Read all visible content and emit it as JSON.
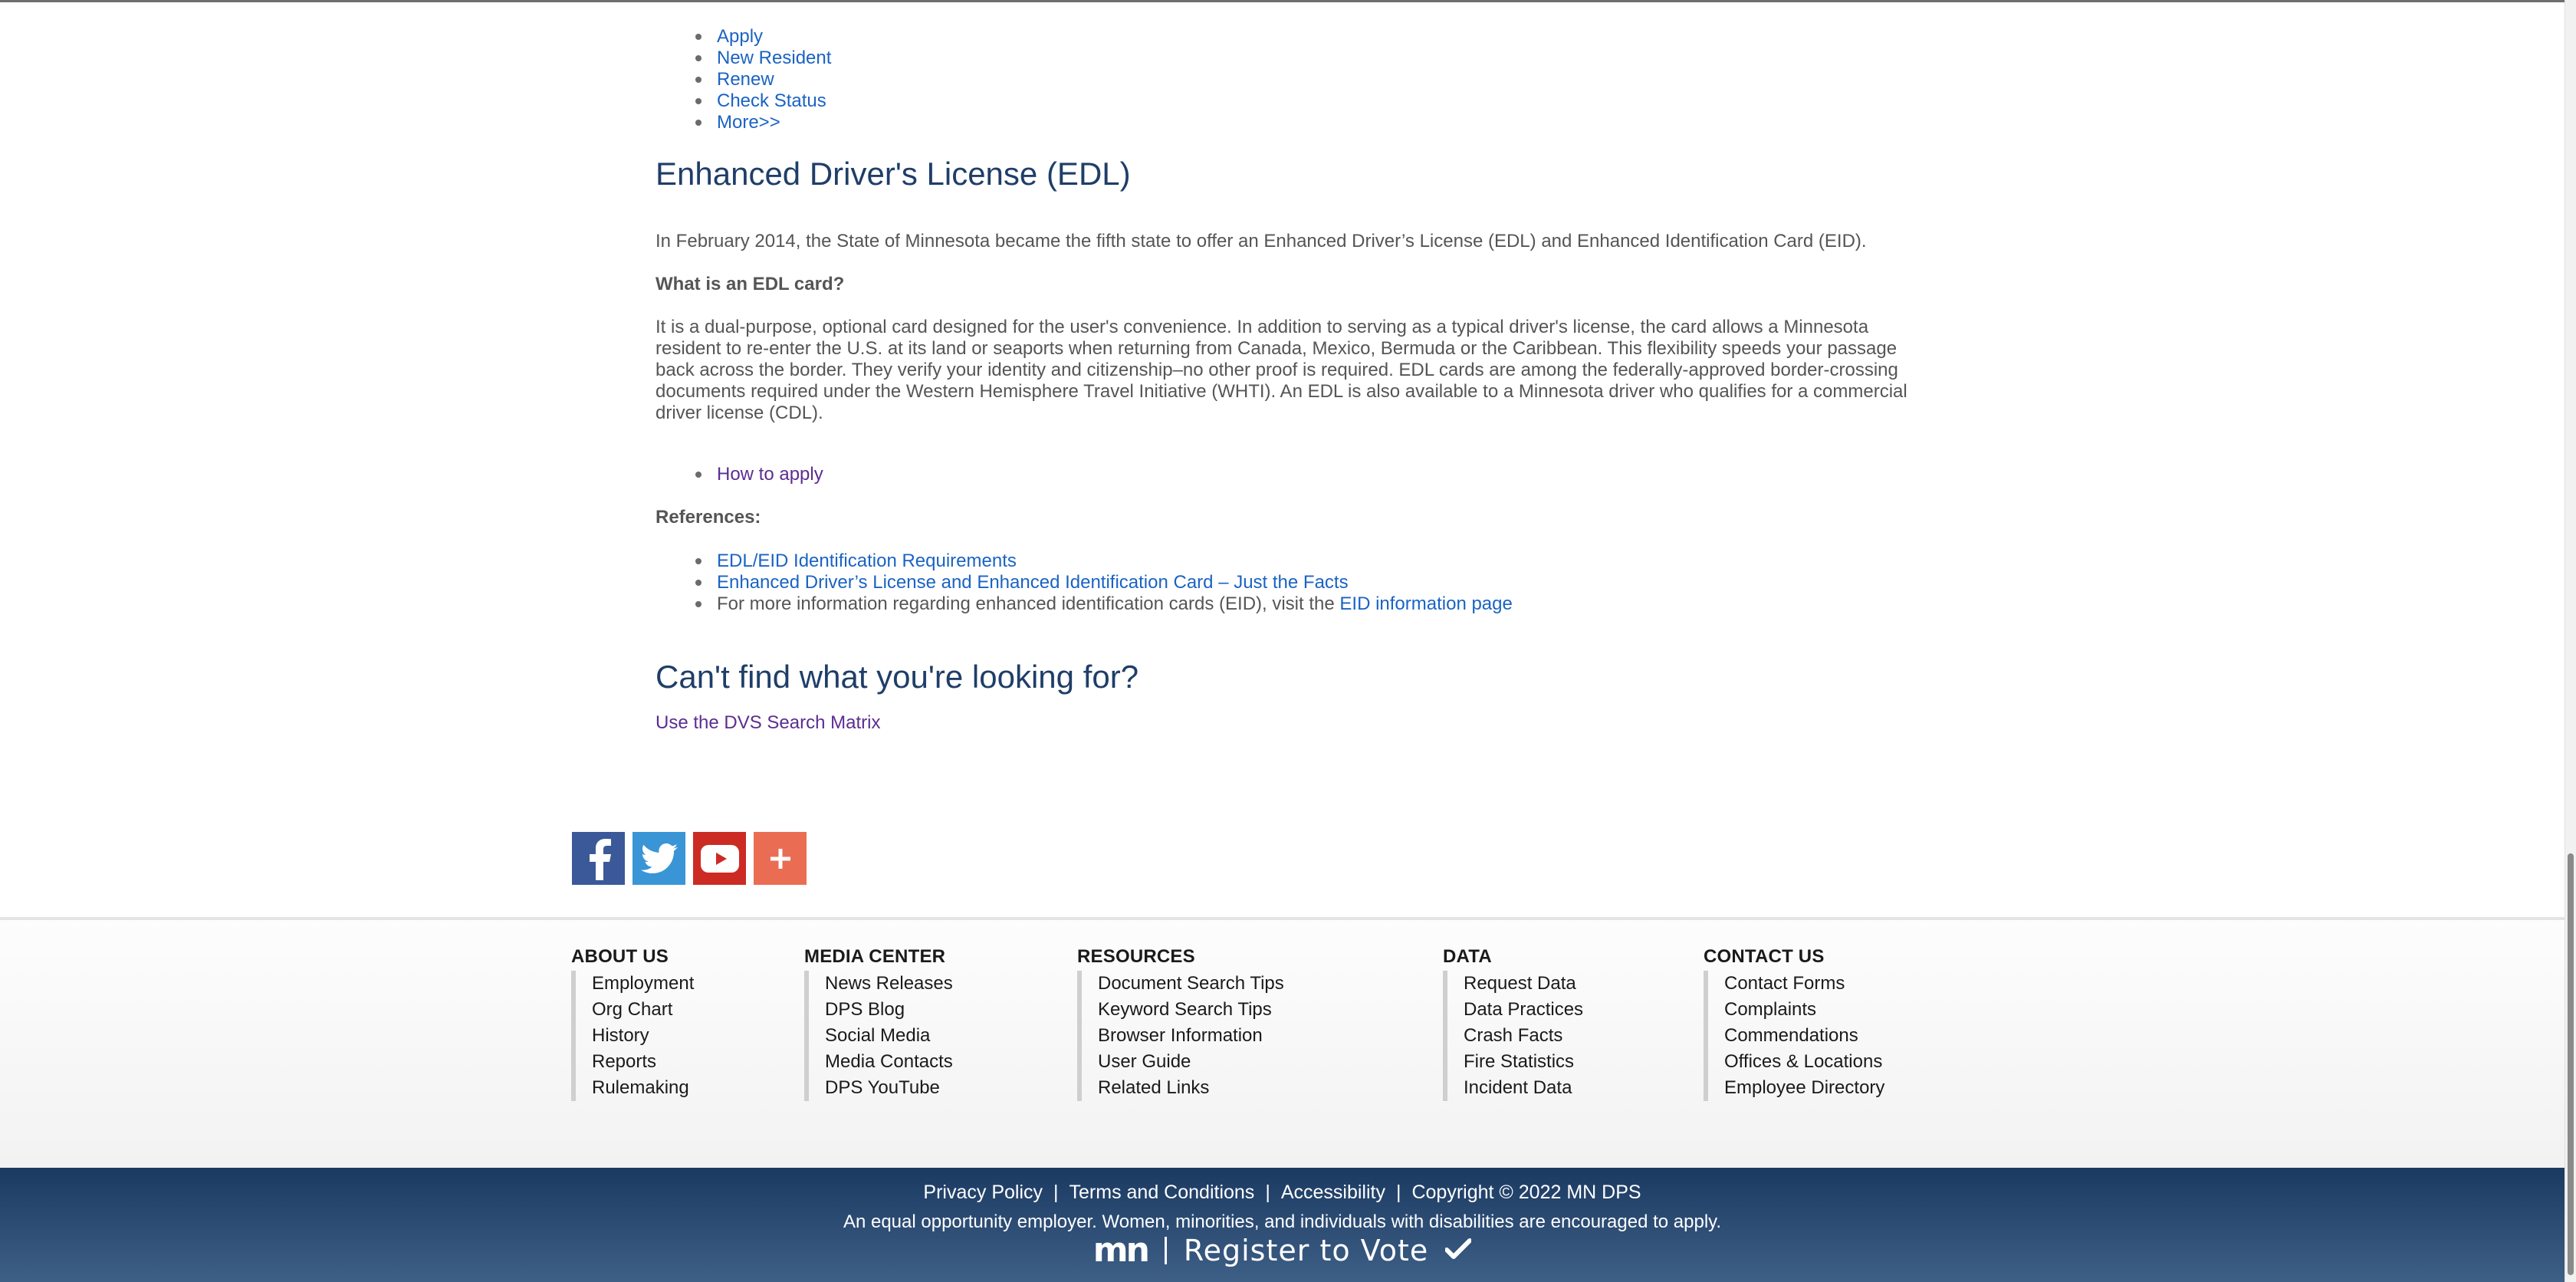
{
  "top_links": [
    "Apply",
    "New Resident",
    "Renew",
    "Check Status",
    "More>>"
  ],
  "edl": {
    "heading": "Enhanced Driver's License (EDL)",
    "intro": "In February 2014, the State of Minnesota became the fifth state to offer an Enhanced Driver’s License (EDL) and Enhanced Identification Card (EID).",
    "question": "What is an EDL card?",
    "description": "It is a dual-purpose, optional card designed for the user's convenience. In addition to serving as a typical driver's license, the card allows a Minnesota resident to re-enter the U.S. at its land or seaports when returning from Canada, Mexico, Bermuda or the Caribbean. This flexibility speeds your passage back across the border. They verify your identity and citizenship–no other proof is required. EDL cards are among the federally-approved border-crossing documents required under the Western Hemisphere Travel Initiative (WHTI). An EDL is also available to a Minnesota driver who qualifies for a commercial driver license (CDL).",
    "how_to_apply": "How to apply",
    "references_label": "References:",
    "ref1": "EDL/EID Identification Requirements",
    "ref2": "Enhanced Driver’s License and Enhanced Identification Card – Just the Facts",
    "ref3_text": "For more information regarding enhanced identification cards (EID), visit the",
    "ref3_link": "EID information page"
  },
  "cant_find": {
    "heading": "Can't find what you're looking for?",
    "link": "Use the DVS Search Matrix"
  },
  "social_icons": [
    "facebook-icon",
    "twitter-icon",
    "youtube-icon",
    "plus-share-icon"
  ],
  "colors": {
    "facebook": "#3b5998",
    "twitter": "#3a95d6",
    "youtube": "#cc2b24",
    "share": "#ea6d53",
    "heading": "#1f3e68",
    "link": "#1a63c4",
    "visited_link": "#5c2d91"
  },
  "footer": {
    "columns": [
      {
        "title": "ABOUT US",
        "items": [
          "Employment",
          "Org Chart",
          "History",
          "Reports",
          "Rulemaking"
        ]
      },
      {
        "title": "MEDIA CENTER",
        "items": [
          "News Releases",
          "DPS Blog",
          "Social Media",
          "Media Contacts",
          "DPS YouTube"
        ]
      },
      {
        "title": "RESOURCES",
        "items": [
          "Document Search Tips",
          "Keyword Search Tips",
          "Browser Information",
          "User Guide",
          "Related Links"
        ]
      },
      {
        "title": "DATA",
        "items": [
          "Request Data",
          "Data Practices",
          "Crash Facts",
          "Fire Statistics",
          "Incident Data"
        ]
      },
      {
        "title": "CONTACT US",
        "items": [
          "Contact Forms",
          "Complaints",
          "Commendations",
          "Offices & Locations",
          "Employee Directory"
        ]
      }
    ]
  },
  "bottom": {
    "links": [
      "Privacy Policy",
      "Terms and Conditions",
      "Accessibility"
    ],
    "copyright": "Copyright © 2022 MN DPS",
    "separator": "|",
    "eoe": "An equal opportunity employer. Women, minorities, and individuals with disabilities are encouraged to apply.",
    "logo_text": "mn",
    "register": "Register to Vote"
  }
}
